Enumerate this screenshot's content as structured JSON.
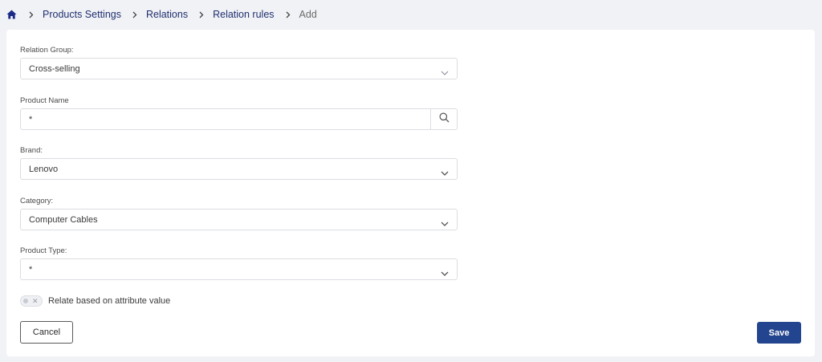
{
  "breadcrumb": {
    "home_icon": "home-icon",
    "items": [
      "Products Settings",
      "Relations",
      "Relation rules"
    ],
    "current": "Add"
  },
  "form": {
    "relation_group": {
      "label": "Relation Group:",
      "value": "Cross-selling"
    },
    "product_name": {
      "label": "Product Name",
      "value": "*"
    },
    "brand": {
      "label": "Brand:",
      "value": "Lenovo"
    },
    "category": {
      "label": "Category:",
      "value": "Computer Cables"
    },
    "product_type": {
      "label": "Product Type:",
      "value": "*"
    },
    "relate_toggle": {
      "label": "Relate based on attribute value",
      "checked": false
    }
  },
  "actions": {
    "cancel_label": "Cancel",
    "save_label": "Save"
  },
  "colors": {
    "accent": "#23448e",
    "breadcrumb_link": "#1f2f6e",
    "background": "#f1f2f6"
  }
}
